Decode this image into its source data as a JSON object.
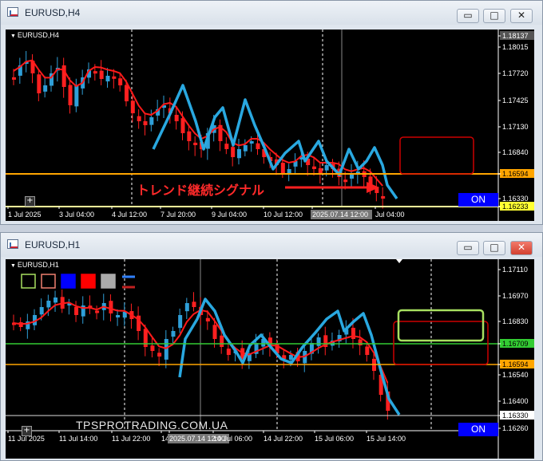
{
  "windows": [
    {
      "title": "EURUSD,H4",
      "symbol_label": "EURUSD,H4",
      "price_labels": [
        "1.18137",
        "1.18015",
        "1.17720",
        "1.17425",
        "1.17130",
        "1.16840",
        "1.16594",
        "1.16330",
        "1.16233"
      ],
      "time_labels": [
        "1 Jul 2025",
        "3 Jul 04:00",
        "4 Jul 12:00",
        "7 Jul 20:00",
        "9 Jul 04:00",
        "10 Jul 12:00",
        "2025.07.14 12:00",
        "Jul 04:00"
      ],
      "signal_text": "トレンド継続シグナル",
      "on_label": "ON"
    },
    {
      "title": "EURUSD,H1",
      "symbol_label": "EURUSD,H1",
      "price_labels": [
        "1.17110",
        "1.16970",
        "1.16830",
        "1.16709",
        "1.16594",
        "1.16540",
        "1.16400",
        "1.16330",
        "1.16260"
      ],
      "time_labels": [
        "11 Jul 2025",
        "11 Jul 14:00",
        "11 Jul 22:00",
        "14",
        "2025.07.14 12:00",
        "14 Jul 06:00",
        "14 Jul 22:00",
        "15 Jul 06:00",
        "15 Jul 14:00"
      ],
      "watermark": "TPSPROTRADING.COM.UA",
      "on_label": "ON"
    }
  ],
  "window_buttons": {
    "minimize": "▭",
    "maximize": "□",
    "close": "✕"
  },
  "colors": {
    "bull": "#2f9fd8",
    "bear": "#ff2020",
    "ma": "#ff1a1a",
    "zigzag": "#29a8e0",
    "level_orange": "#ffa500",
    "level_yellow": "#ffff33",
    "level_green": "#33cc33",
    "box_red": "#cc0000",
    "box_green": "#a8e060",
    "on_button": "#0000ff"
  }
}
